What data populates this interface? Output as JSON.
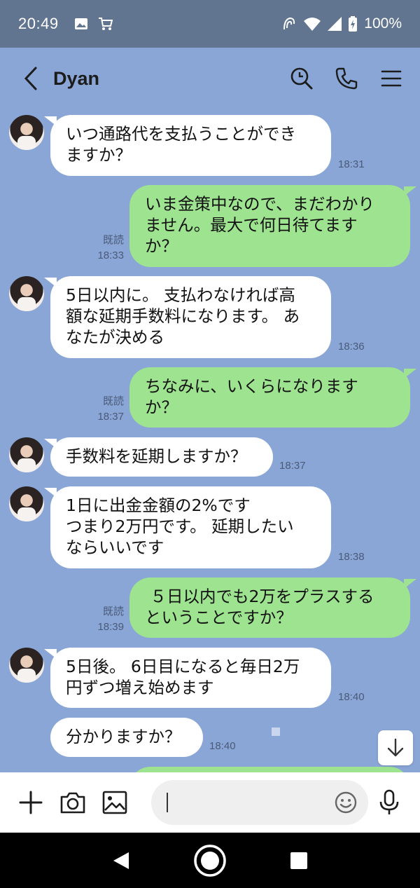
{
  "status_bar": {
    "time": "20:49",
    "battery": "100%",
    "icons": [
      "image-icon",
      "cart-icon",
      "nfc-icon",
      "wifi-icon",
      "signal-icon",
      "battery-icon"
    ]
  },
  "header": {
    "title": "Dyan",
    "icons": [
      "back-arrow-icon",
      "search-icon",
      "phone-icon",
      "menu-icon"
    ]
  },
  "messages": [
    {
      "side": "in",
      "avatar": true,
      "text": "いつ通路代を支払うことができ\nますか？",
      "time": "18:31"
    },
    {
      "side": "out",
      "read": "既読",
      "text": "いま金策中なので、まだわかり\nません。最大で何日待てます\nか？",
      "time": "18:33"
    },
    {
      "side": "in",
      "avatar": true,
      "text": "5日以内に。 支払わなければ高\n額な延期手数料になります。 あ\nなたが決める",
      "time": "18:36"
    },
    {
      "side": "out",
      "read": "既読",
      "text": "ちなみに、いくらになります\nか？",
      "time": "18:37"
    },
    {
      "side": "in",
      "avatar": true,
      "text": "手数料を延期しますか？",
      "time": "18:37"
    },
    {
      "side": "in",
      "avatar": true,
      "text": "1日に出金金額の2%です\nつまり2万円です。 延期したい\nならいいです",
      "time": "18:38"
    },
    {
      "side": "out",
      "read": "既読",
      "text": " ５日以内でも2万をプラスする\nということですか？",
      "time": "18:39"
    },
    {
      "side": "in",
      "avatar": true,
      "text": "5日後。 6日目になると毎日2万\n円ずつ増え始めます",
      "time": "18:40"
    },
    {
      "side": "in",
      "avatar": false,
      "text": "分かりますか？",
      "time": "18:40"
    }
  ],
  "input_bar": {
    "placeholder": "",
    "icons": [
      "plus-icon",
      "camera-icon",
      "image-icon",
      "emoji-icon",
      "mic-icon"
    ]
  },
  "colors": {
    "status_bar": "#617591",
    "chat_background": "#8aa6d6",
    "incoming_bubble": "#ffffff",
    "outgoing_bubble": "#9ee38f",
    "meta_text": "#4a5a78"
  }
}
